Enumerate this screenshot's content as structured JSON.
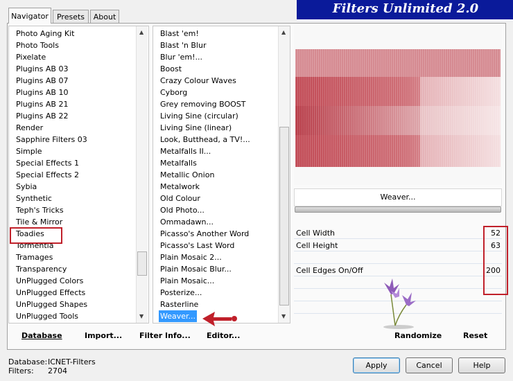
{
  "window": {
    "title": "Filters Unlimited 2.0"
  },
  "tabs": [
    {
      "label": "Navigator",
      "active": true
    },
    {
      "label": "Presets",
      "active": false
    },
    {
      "label": "About",
      "active": false
    }
  ],
  "categories": {
    "items": [
      "Photo Aging Kit",
      "Photo Tools",
      "Pixelate",
      "Plugins AB 03",
      "Plugins AB 07",
      "Plugins AB 10",
      "Plugins AB 21",
      "Plugins AB 22",
      "Render",
      "Sapphire Filters 03",
      "Simple",
      "Special Effects 1",
      "Special Effects 2",
      "Sybia",
      "Synthetic",
      "Teph's Tricks",
      "Tile & Mirror",
      "Toadies",
      "Tormentia",
      "Tramages",
      "Transparency",
      "UnPlugged Colors",
      "UnPlugged Effects",
      "UnPlugged Shapes",
      "UnPlugged Tools"
    ],
    "highlighted": "Toadies"
  },
  "filters": {
    "items": [
      "Blast 'em!",
      "Blast 'n Blur",
      "Blur 'em!...",
      "Boost",
      "Crazy Colour Waves",
      "Cyborg",
      "Grey removing BOOST",
      "Living Sine (circular)",
      "Living Sine (linear)",
      "Look, Butthead, a TV!...",
      "Metalfalls II...",
      "Metalfalls",
      "Metallic Onion",
      "Metalwork",
      "Old Colour",
      "Old Photo...",
      "Ommadawn...",
      "Picasso's Another Word",
      "Picasso's Last Word",
      "Plain Mosaic 2...",
      "Plain Mosaic Blur...",
      "Plain Mosaic...",
      "Posterize...",
      "Rasterline",
      "Weaver..."
    ],
    "selected": "Weaver..."
  },
  "preview": {
    "filter_name": "Weaver..."
  },
  "params": [
    {
      "label": "Cell Width",
      "value": "52"
    },
    {
      "label": "Cell Height",
      "value": "63"
    },
    {
      "label": "Cell Edges On/Off",
      "value": "200"
    }
  ],
  "buttons": {
    "database": "Database",
    "import": "Import...",
    "filter_info": "Filter Info...",
    "editor": "Editor...",
    "randomize": "Randomize",
    "reset": "Reset",
    "apply": "Apply",
    "cancel": "Cancel",
    "help": "Help"
  },
  "status": {
    "database_label": "Database:",
    "database_value": "ICNET-Filters",
    "filters_label": "Filters:",
    "filters_value": "2704"
  },
  "colors": {
    "accent_red": "#c0202a",
    "banner": "#0a1a9a",
    "selection": "#3399ff"
  }
}
